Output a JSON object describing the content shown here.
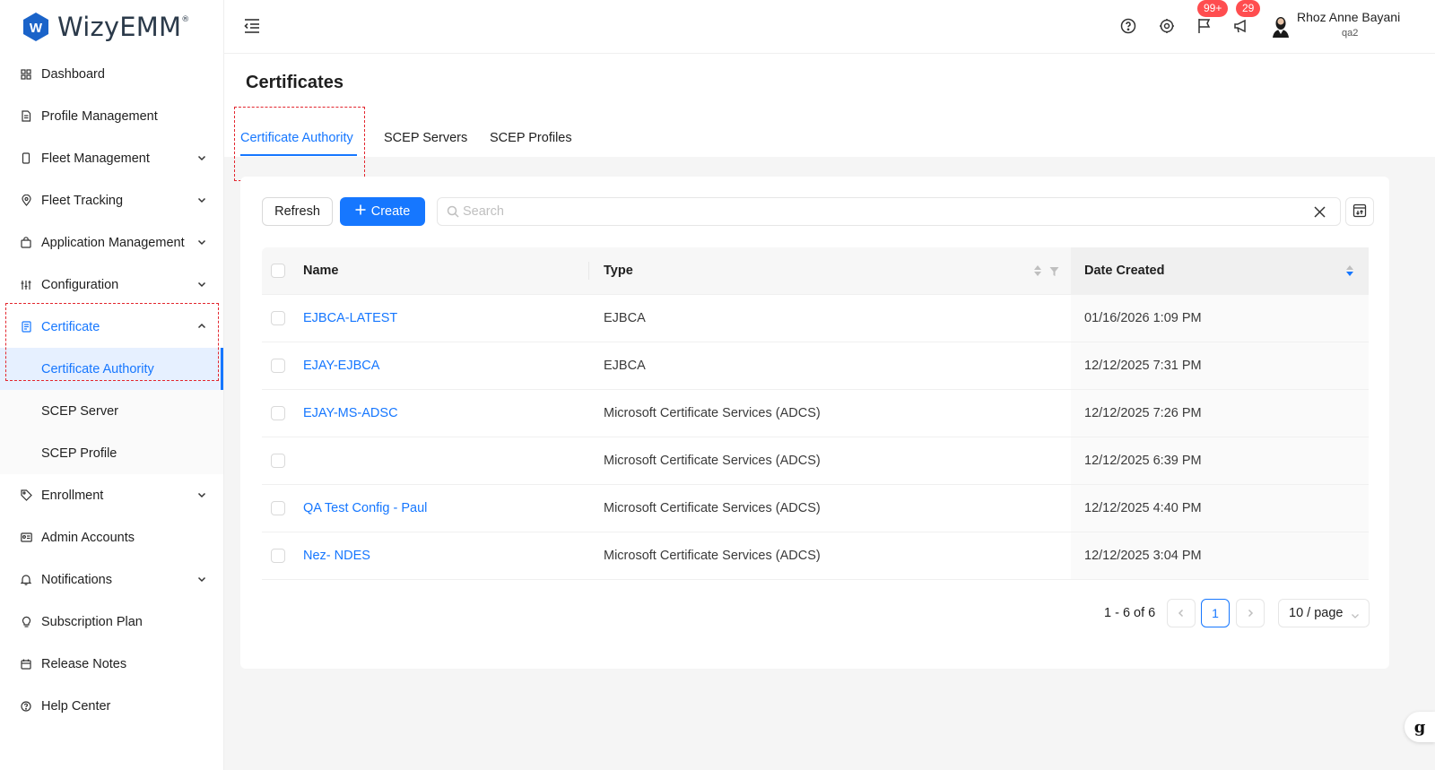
{
  "app": {
    "brand": "WizyEMM",
    "brand_mark": "®",
    "logo_letter": "W"
  },
  "sidebar": {
    "items": [
      {
        "label": "Dashboard",
        "icon": "dashboard-icon"
      },
      {
        "label": "Profile Management",
        "icon": "file-icon"
      },
      {
        "label": "Fleet Management",
        "icon": "phone-icon",
        "expandable": true
      },
      {
        "label": "Fleet Tracking",
        "icon": "location-icon",
        "expandable": true
      },
      {
        "label": "Application Management",
        "icon": "bag-icon",
        "expandable": true
      },
      {
        "label": "Configuration",
        "icon": "sliders-icon",
        "expandable": true
      },
      {
        "label": "Certificate",
        "icon": "certificate-icon",
        "expandable": true,
        "expanded": true
      },
      {
        "label": "Enrollment",
        "icon": "tag-icon",
        "expandable": true
      },
      {
        "label": "Admin Accounts",
        "icon": "id-card-icon"
      },
      {
        "label": "Notifications",
        "icon": "bell-icon",
        "expandable": true
      },
      {
        "label": "Subscription Plan",
        "icon": "bulb-icon"
      },
      {
        "label": "Release Notes",
        "icon": "calendar-icon"
      },
      {
        "label": "Help Center",
        "icon": "help-icon"
      }
    ],
    "certificate_children": [
      {
        "label": "Certificate Authority",
        "selected": true
      },
      {
        "label": "SCEP Server"
      },
      {
        "label": "SCEP Profile"
      }
    ]
  },
  "header": {
    "flag_badge": "99+",
    "announce_badge": "29",
    "user_name": "Rhoz Anne Bayani",
    "user_org": "qa2"
  },
  "page": {
    "title": "Certificates",
    "tabs": [
      {
        "label": "Certificate Authority",
        "active": true
      },
      {
        "label": "SCEP Servers"
      },
      {
        "label": "SCEP Profiles"
      }
    ]
  },
  "toolbar": {
    "refresh_label": "Refresh",
    "create_label": "Create",
    "search_placeholder": "Search",
    "search_value": ""
  },
  "table": {
    "columns": [
      "Name",
      "Type",
      "Date Created"
    ],
    "rows": [
      {
        "name": "EJBCA-LATEST",
        "type": "EJBCA",
        "date": "01/16/2026 1:09 PM"
      },
      {
        "name": "EJAY-EJBCA",
        "type": "EJBCA",
        "date": "12/12/2025 7:31 PM"
      },
      {
        "name": "EJAY-MS-ADSC",
        "type": "Microsoft Certificate Services (ADCS)",
        "date": "12/12/2025 7:26 PM"
      },
      {
        "name": "",
        "type": "Microsoft Certificate Services (ADCS)",
        "date": "12/12/2025 6:39 PM"
      },
      {
        "name": "QA Test Config - Paul",
        "type": "Microsoft Certificate Services (ADCS)",
        "date": "12/12/2025 4:40 PM"
      },
      {
        "name": "Nez- NDES",
        "type": "Microsoft Certificate Services (ADCS)",
        "date": "12/12/2025 3:04 PM"
      }
    ]
  },
  "pagination": {
    "summary": "1 - 6 of 6",
    "current_page": "1",
    "page_size": "10 / page"
  },
  "colors": {
    "accent": "#1677ff",
    "badge": "#ff4d4f",
    "highlight_box": "#e3262e"
  },
  "floating": {
    "grammarly_letter": "g"
  }
}
